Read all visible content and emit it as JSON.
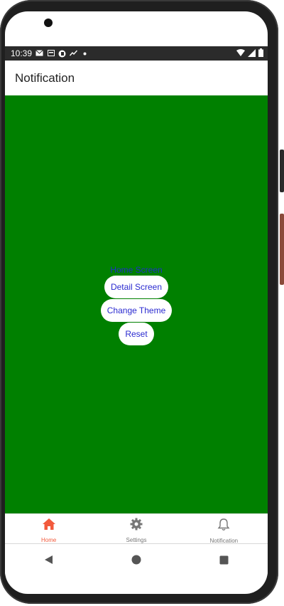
{
  "status_bar": {
    "time": "10:39"
  },
  "app_bar": {
    "title": "Notification"
  },
  "main": {
    "background": "#008000",
    "home_label": "Home Screen",
    "buttons": [
      {
        "label": "Detail Screen"
      },
      {
        "label": "Change Theme"
      },
      {
        "label": "Reset"
      }
    ]
  },
  "tab_bar": {
    "active_color": "#f25a3c",
    "items": [
      {
        "label": "Home",
        "icon": "home-icon",
        "active": true
      },
      {
        "label": "Settings",
        "icon": "gear-icon",
        "active": false
      },
      {
        "label": "Notification",
        "icon": "bell-icon",
        "active": false
      }
    ]
  },
  "system_nav": {
    "icons": [
      "back-icon",
      "home-circle-icon",
      "recents-icon"
    ]
  }
}
